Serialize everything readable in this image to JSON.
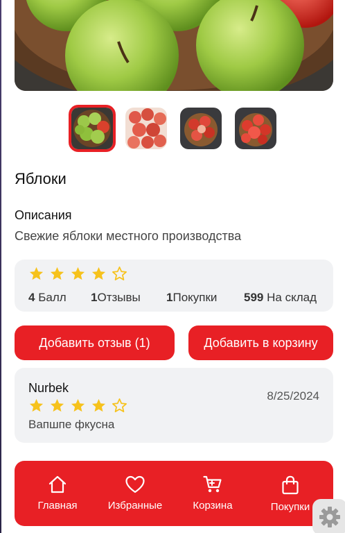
{
  "product": {
    "title": "Яблоки",
    "description_label": "Описания",
    "description": "Свежие яблоки местного производства",
    "rating": 4,
    "max_rating": 5
  },
  "thumbnails": [
    {
      "icon": "green-apples-thumbnail",
      "selected": true
    },
    {
      "icon": "red-apples-thumbnail",
      "selected": false
    },
    {
      "icon": "red-apples-basket-thumbnail",
      "selected": false
    },
    {
      "icon": "red-apples-basket-thumbnail-2",
      "selected": false
    }
  ],
  "stats": {
    "score_value": "4",
    "score_label": "Балл",
    "reviews_value": "1",
    "reviews_label": "Отзывы",
    "purchases_value": "1",
    "purchases_label": "Покупки",
    "stock_value": "599",
    "stock_label": "На склад"
  },
  "actions": {
    "add_review": "Добавить отзыв (1)",
    "add_to_cart": "Добавить в корзину"
  },
  "review": {
    "author": "Nurbek",
    "date": "8/25/2024",
    "rating": 4,
    "text": "Вапшпе фкусна"
  },
  "nav": {
    "items": [
      {
        "label": "Главная",
        "icon": "home-icon"
      },
      {
        "label": "Избранные",
        "icon": "heart-icon"
      },
      {
        "label": "Корзина",
        "icon": "cart-icon"
      },
      {
        "label": "Покупки",
        "icon": "shopping-bag-icon"
      }
    ]
  },
  "colors": {
    "accent": "#e82025",
    "card_bg": "#f1f2f4",
    "star": "#f6c21c"
  }
}
